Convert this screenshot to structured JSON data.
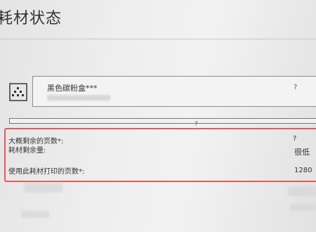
{
  "page": {
    "title": "耗材状态"
  },
  "supply": {
    "name": "黑色碳粉盒***",
    "help": "?",
    "icon": "toner-cartridge-icon",
    "level_help": "?"
  },
  "details": {
    "pages_remaining_label": "大概剩余的页数*:",
    "pages_remaining_value": "?",
    "supply_level_label": "耗材剩余量:",
    "supply_level_value": "很低",
    "pages_printed_label": "使用此耗材打印的页数*:",
    "pages_printed_value": "1280"
  },
  "colors": {
    "highlight": "#e25a5a"
  }
}
